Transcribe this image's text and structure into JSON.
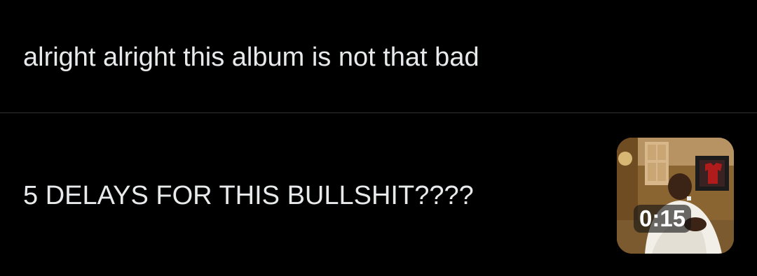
{
  "posts": [
    {
      "text": "alright alright this album is not that bad"
    },
    {
      "text": "5 DELAYS FOR THIS BULLSHIT????",
      "media": {
        "type": "video",
        "duration": "0:15",
        "description_icon": "video-thumbnail"
      }
    }
  ],
  "colors": {
    "background": "#000000",
    "text": "#e7e9ea",
    "divider": "#2f3336",
    "badge_bg": "rgba(20,20,20,0.62)"
  }
}
